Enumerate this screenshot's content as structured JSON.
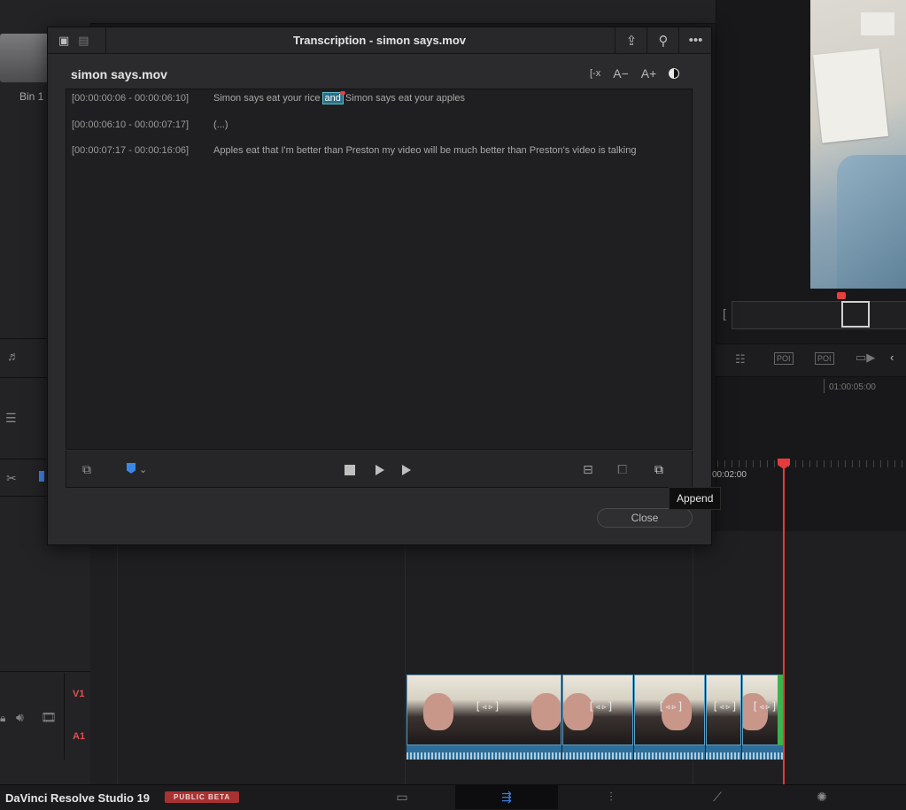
{
  "dialog": {
    "title": "Transcription - simon says.mov",
    "file_name": "simon says.mov",
    "close_label": "Close",
    "tooltip": "Append",
    "font_tools": [
      "[-x",
      "A−",
      "A+"
    ],
    "transcript": [
      {
        "timestamp": "[00:00:00:06 - 00:00:06:10]",
        "pre": "Simon says eat your rice",
        "highlight": "and",
        "post": "Simon says eat your apples"
      },
      {
        "timestamp": "[00:00:06:10 - 00:00:07:17]",
        "pre": "(...)",
        "highlight": "",
        "post": ""
      },
      {
        "timestamp": "[00:00:07:17 - 00:00:16:06]",
        "pre": "Apples eat that I'm better than Preston my video will be much better than Preston's video is talking",
        "highlight": "",
        "post": ""
      }
    ]
  },
  "left_panel": {
    "bin_label": "Bin 1",
    "track_v1": "V1",
    "track_a1": "A1"
  },
  "viewer": {
    "timecode": "01:00:05:00",
    "poi1": "POI",
    "poi2": "POI"
  },
  "timeline": {
    "ruler_time": "00:02:00"
  },
  "bottom_bar": {
    "app_name": "DaVinci Resolve Studio 19",
    "badge": "PUBLIC BETA"
  },
  "colors": {
    "accent_blue": "#3c86e8",
    "playhead_red": "#e53b3b",
    "badge_red": "#a83232",
    "highlight": "#2b6f8a"
  }
}
